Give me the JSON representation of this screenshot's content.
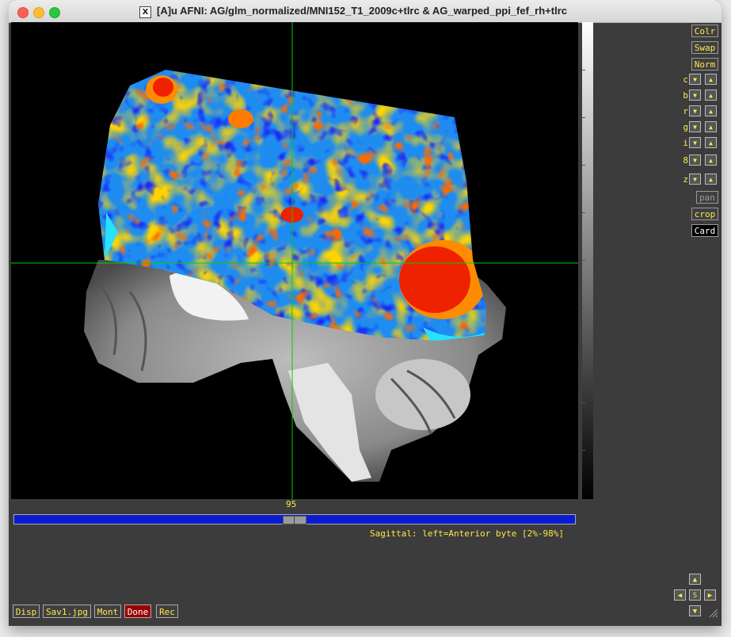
{
  "window": {
    "title": "[A]u AFNI: AG/glm_normalized/MNI152_T1_2009c+tlrc & AG_warped_ppi_fef_rh+tlrc",
    "x_icon_glyph": "X"
  },
  "right_panel": {
    "colr": "Colr",
    "swap": "Swap",
    "norm": "Norm",
    "rows": [
      {
        "label": "c"
      },
      {
        "label": "b"
      },
      {
        "label": "r"
      },
      {
        "label": "g"
      },
      {
        "label": "i"
      },
      {
        "label": "8"
      },
      {
        "label": "z"
      }
    ],
    "down_glyph": "▼",
    "up_glyph": "▲",
    "pan": "pan",
    "crop": "crop",
    "card": "Card"
  },
  "slider": {
    "value": "95",
    "position_fraction": 0.5
  },
  "status_text": "Sagittal: left=Anterior byte [2%-98%]",
  "bottom_buttons": {
    "disp": "Disp",
    "save": "Sav1.jpg",
    "mont": "Mont",
    "done": "Done",
    "rec": "Rec"
  },
  "pan_pad": {
    "up": "▲",
    "left": "◀",
    "center": "S",
    "right": "▶",
    "down": "▼"
  },
  "colors": {
    "button_text": "#ffe94a",
    "done_bg": "#9b0000",
    "slider_track": "#0a1cd0",
    "crosshair": "#00d000"
  }
}
